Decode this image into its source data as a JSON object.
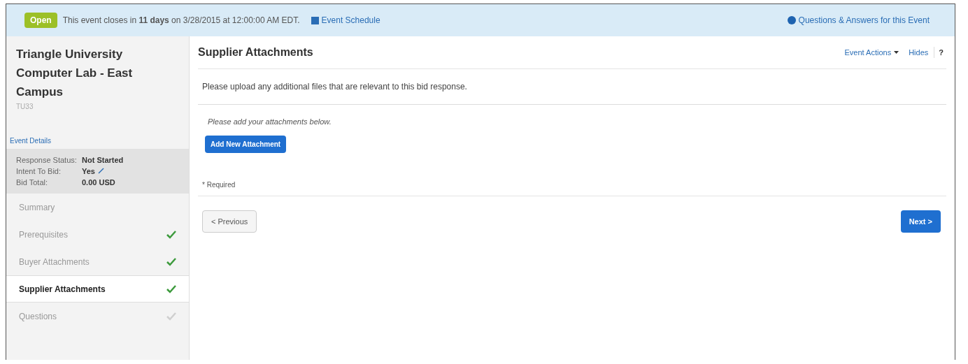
{
  "banner": {
    "badge": "Open",
    "message": "This event closes in **11 days** on 3/28/2015 at 12:00:00 AM EDT.",
    "schedule_link": "Event Schedule",
    "qa_link": "Questions & Answers for this Event"
  },
  "sidebar": {
    "title": "Triangle University Computer Lab - East Campus",
    "code": "TU33",
    "details_link": "Event Details",
    "summary": [
      {
        "label": "Response Status:",
        "value": "Not Started",
        "editable": false
      },
      {
        "label": "Intent To Bid:",
        "value": "Yes",
        "editable": true
      },
      {
        "label": "Bid Total:",
        "value": "0.00 USD",
        "editable": false
      }
    ],
    "nav": [
      {
        "label": "Summary",
        "selected": false
      },
      {
        "label": "Prerequisites",
        "selected": false,
        "checked": true
      },
      {
        "label": "Buyer Attachments",
        "selected": false,
        "checked": true
      },
      {
        "label": "Supplier Attachments",
        "selected": true,
        "checked": true
      },
      {
        "label": "Questions",
        "selected": false,
        "checked": false
      }
    ]
  },
  "main": {
    "title": "Supplier Attachments",
    "actions_menu": "Event Actions",
    "help_link": "Hides",
    "help_icon": "?",
    "intro": "Please upload any additional files that are relevant to this bid response.",
    "instruction": "Please add your attachments below.",
    "add_button": "Add New Attachment",
    "required_note": "* Required",
    "previous_button": "< Previous",
    "next_button": "Next >"
  }
}
